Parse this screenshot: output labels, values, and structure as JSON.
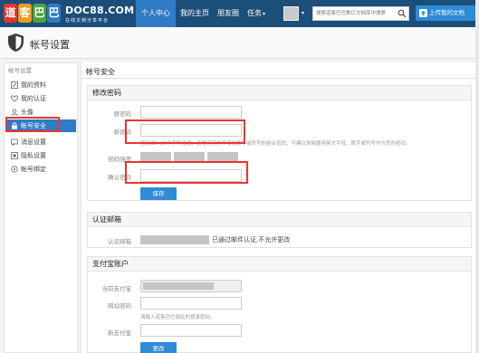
{
  "topbar": {
    "logo_chars": [
      "道",
      "客",
      "巴",
      "巴"
    ],
    "logo_colors": [
      "#e8332a",
      "#f29b1d",
      "#4aa53c",
      "#2f7bc4"
    ],
    "brand_name": "DOC88.COM",
    "brand_sub": "在线文档分享平台",
    "nav": [
      {
        "label": "个人中心",
        "active": true
      },
      {
        "label": "我的主页",
        "active": false
      },
      {
        "label": "朋友圈",
        "active": false
      },
      {
        "label": "任务",
        "active": false
      }
    ],
    "nav_caret": "▾",
    "search_placeholder": "搜索道客巴巴数亿文档库中搜索",
    "upload_label": "上传我的文档"
  },
  "page_header": {
    "title": "帐号设置"
  },
  "sidebar": {
    "group_label": "帐号设置",
    "items": [
      {
        "label": "我的资料",
        "icon": "edit-icon"
      },
      {
        "label": "我的认证",
        "icon": "heart-icon"
      },
      {
        "label": "头像",
        "icon": "user-icon"
      },
      {
        "label": "帐号安全",
        "icon": "lock-icon",
        "active": true
      },
      {
        "label": "消息设置",
        "icon": "message-icon"
      },
      {
        "label": "隐私设置",
        "icon": "privacy-icon"
      },
      {
        "label": "帐号绑定",
        "icon": "link-icon"
      }
    ]
  },
  "main": {
    "section_title": "帐号安全",
    "change_password": {
      "title": "修改密码",
      "old_label": "原密码",
      "new_label": "新密码",
      "new_hint": "密码由6-16个字符组成，请使用英文字母加数字或符号的组合密码，不建议单独使用英文字母、数字或符号作为您的密码。",
      "strength_label": "密码强度",
      "confirm_label": "确认密码",
      "save_label": "保存"
    },
    "email": {
      "title": "认证邮箱",
      "label": "认证邮箱",
      "status": "已通过邮件认证,不允许更改"
    },
    "alipay": {
      "title": "支付宝账户",
      "current_label": "当前支付宝",
      "site_pw_label": "网站密码",
      "site_pw_hint": "请输入道客巴巴网站的登录密码。",
      "new_label": "新支付宝",
      "change_label": "更改"
    }
  }
}
